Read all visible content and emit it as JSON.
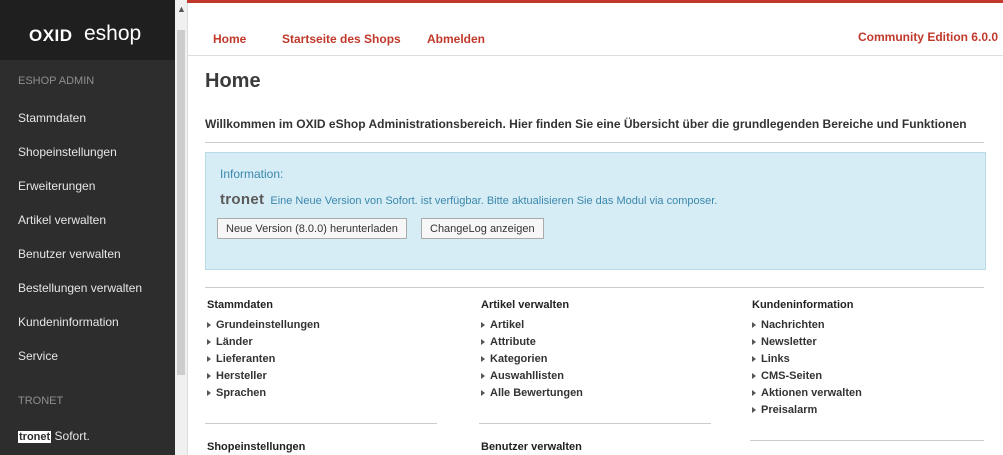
{
  "logo": {
    "brand": "OXID",
    "product": "eshop"
  },
  "sidebar": {
    "section_admin": "ESHOP ADMIN",
    "items": [
      {
        "label": "Stammdaten"
      },
      {
        "label": "Shopeinstellungen"
      },
      {
        "label": "Erweiterungen"
      },
      {
        "label": "Artikel verwalten"
      },
      {
        "label": "Benutzer verwalten"
      },
      {
        "label": "Bestellungen verwalten"
      },
      {
        "label": "Kundeninformation"
      },
      {
        "label": "Service"
      }
    ],
    "section_tronet": "TRONET",
    "tronet_badge": "tronet",
    "tronet_item": "Sofort."
  },
  "topnav": {
    "links": [
      "Home",
      "Startseite des Shops",
      "Abmelden"
    ],
    "edition": "Community Edition 6.0.0"
  },
  "main": {
    "title": "Home",
    "welcome": "Willkommen im OXID eShop Administrationsbereich. Hier finden Sie eine Übersicht über die grundlegenden Bereiche und Funktionen",
    "info": {
      "label": "Information:",
      "logo": "tronet",
      "message": "Eine Neue Version von Sofort. ist verfügbar. Bitte aktualisieren Sie das Modul via composer.",
      "download_button": "Neue Version (8.0.0) herunterladen",
      "changelog_button": "ChangeLog anzeigen"
    },
    "columns": [
      {
        "title": "Stammdaten",
        "links": [
          "Grundeinstellungen",
          "Länder",
          "Lieferanten",
          "Hersteller",
          "Sprachen"
        ]
      },
      {
        "title": "Artikel verwalten",
        "links": [
          "Artikel",
          "Attribute",
          "Kategorien",
          "Auswahllisten",
          "Alle Bewertungen"
        ]
      },
      {
        "title": "Kundeninformation",
        "links": [
          "Nachrichten",
          "Newsletter",
          "Links",
          "CMS-Seiten",
          "Aktionen verwalten",
          "Preisalarm"
        ]
      }
    ],
    "columns_row2": [
      {
        "title": "Shopeinstellungen"
      },
      {
        "title": "Benutzer verwalten"
      }
    ]
  }
}
